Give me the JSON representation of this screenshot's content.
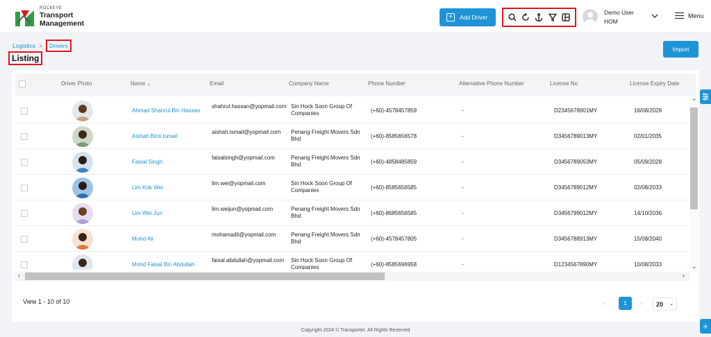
{
  "brand": {
    "top": "ROCKEYE",
    "line1": "Transport",
    "line2": "Management"
  },
  "header": {
    "add_label": "Add Driver",
    "user_name": "Demo User",
    "user_role": "HOM",
    "menu_label": "Menu",
    "tools": [
      "search-icon",
      "refresh-icon",
      "anchor-icon",
      "filter-icon",
      "columns-icon"
    ]
  },
  "breadcrumb": {
    "parent": "Logistics",
    "separator": ">",
    "current": "Drivers"
  },
  "page": {
    "title": "Listing",
    "import_label": "Import"
  },
  "columns": [
    "Driver Photo",
    "Name",
    "Email",
    "Company Name",
    "Phone Number",
    "Alternative Phone Number",
    "License No",
    "License Expiry Date"
  ],
  "sort_indicator": "▲",
  "rows": [
    {
      "name": "Ahmad Shahrul Bin Hassan",
      "email": "shahrul.hassan@yopmail.com",
      "company": "Sin Hock Soon Group Of Companies",
      "phone": "(+60)-4578457859",
      "alt": "-",
      "license": "D2345678901MY",
      "expiry": "16/08/2028"
    },
    {
      "name": "Aishah Binti Ismail",
      "email": "aishah.ismail@yopmail.com",
      "company": "Penang Freight Movers Sdn Bhd",
      "phone": "(+60)-8585656578",
      "alt": "-",
      "license": "D3456789013MY",
      "expiry": "02/01/2035"
    },
    {
      "name": "Faisal Singh",
      "email": "faisalsingh@yopmail.com",
      "company": "Penang Freight Movers Sdn Bhd",
      "phone": "(+60)-4858485859",
      "alt": "-",
      "license": "D3456789053MY",
      "expiry": "05/09/2028"
    },
    {
      "name": "Lim Kok Wei",
      "email": "lim.wei@yopmail.com",
      "company": "Sin Hock Soon Group Of Companies",
      "phone": "(+60)-8585656585",
      "alt": "-",
      "license": "D3456789012MY",
      "expiry": "02/08/2033"
    },
    {
      "name": "Lim Wei Jun",
      "email": "lim.weijun@yopmail.com",
      "company": "Penang Freight Movers Sdn Bhd",
      "phone": "(+60)-8685656585",
      "alt": "-",
      "license": "D3456799012MY",
      "expiry": "14/10/2036"
    },
    {
      "name": "Mohd Ali",
      "email": "mohamadli@yopmail.com",
      "company": "Penang Freight Movers Sdn Bhd",
      "phone": "(+60)-4578457805",
      "alt": "-",
      "license": "D3456788913MY",
      "expiry": "15/08/2040"
    },
    {
      "name": "Mohd Faisal Bin Abdullah",
      "email": "faisal.abdullah@yopmail.com",
      "company": "Sin Hock Soon Group Of Companies",
      "phone": "(+60)-8585696958",
      "alt": "-",
      "license": "D1234567890MY",
      "expiry": "10/08/2033"
    }
  ],
  "pagination": {
    "view_text": "View 1 - 10 of 10",
    "current_page": "1",
    "page_size": "20",
    "prev": "‹",
    "next": "›",
    "size_caret": "⌄"
  },
  "footer": {
    "copyright": "Copyright 2024 © Transporter. All Rights Reserved"
  },
  "colors": {
    "accent": "#1e94d6",
    "highlight": "#e0141b"
  }
}
